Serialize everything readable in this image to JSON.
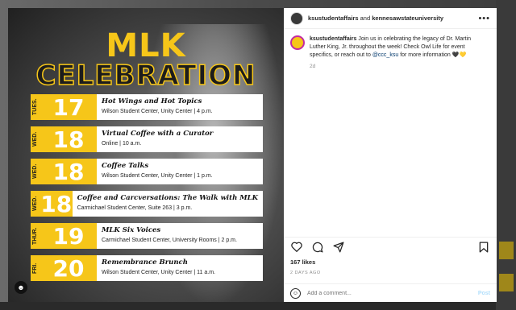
{
  "image": {
    "title_line1": "MLK",
    "title_line2": "CELEBRATION",
    "accent_color": "#f6c619",
    "events": [
      {
        "day": "TUES.",
        "date": "17",
        "name": "Hot Wings and Hot Topics",
        "detail": "Wilson Student Center, Unity Center | 4 p.m."
      },
      {
        "day": "WED.",
        "date": "18",
        "name": "Virtual Coffee with a Curator",
        "detail": "Online | 10 a.m."
      },
      {
        "day": "WED.",
        "date": "18",
        "name": "Coffee Talks",
        "detail": "Wilson Student Center, Unity Center | 1 p.m."
      },
      {
        "day": "WED.",
        "date": "18",
        "name": "Coffee and Carcversations: The Walk with MLK",
        "detail": "Carmichael Student Center, Suite 263 | 3 p.m."
      },
      {
        "day": "THUR.",
        "date": "19",
        "name": "MLK Six Voices",
        "detail": "Carmichael Student Center, University Rooms | 2 p.m."
      },
      {
        "day": "FRI.",
        "date": "20",
        "name": "Remembrance Brunch",
        "detail": "Wilson Student Center, Unity Center | 11 a.m."
      }
    ],
    "tag_icon": "user-tag-icon"
  },
  "panel": {
    "header": {
      "user": "ksustudentaffairs",
      "connector": "and",
      "collaborator": "kennesawstateuniversity",
      "more_icon": "more-options-icon"
    },
    "caption": {
      "user": "ksustudentaffairs",
      "text": "Join us in celebrating the legacy of Dr. Martin Luther King, Jr. throughout the week! Check Owl Life for event specifics, or reach out to",
      "mention": "@ccc_ksu",
      "text_end": "for more information 🖤💛",
      "time": "2d"
    },
    "actions": {
      "like_icon": "heart-icon",
      "comment_icon": "comment-icon",
      "share_icon": "share-icon",
      "save_icon": "bookmark-icon"
    },
    "likes": "167 likes",
    "date": "2 DAYS AGO",
    "comment": {
      "emoji_icon": "emoji-icon",
      "placeholder": "Add a comment...",
      "post_label": "Post"
    }
  }
}
